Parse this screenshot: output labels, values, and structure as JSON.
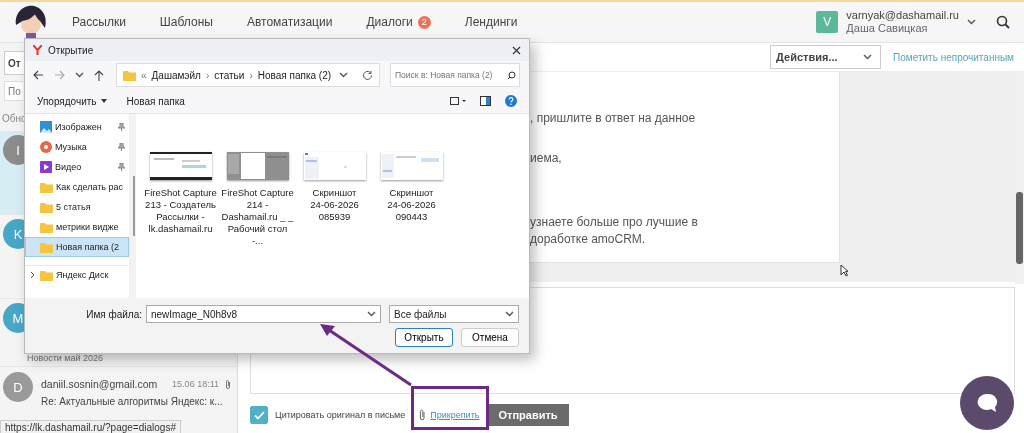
{
  "top_nav": {
    "links": [
      {
        "label": "Рассылки"
      },
      {
        "label": "Шаблоны"
      },
      {
        "label": "Автоматизации"
      },
      {
        "label": "Диалоги",
        "badge": "2"
      },
      {
        "label": "Лендинги"
      }
    ],
    "user": {
      "initial": "V",
      "email": "varnyak@dashamail.ru",
      "name": "Даша Савицкая"
    }
  },
  "sidebar": {
    "sort_value": "От",
    "search_placeholder": "По",
    "refresh_label": "Обно",
    "conversations": [
      {
        "initial": "I",
        "color": "#8c8c8c",
        "selected": true
      },
      {
        "initial": "K",
        "color": "#47a7c7",
        "selected": false
      },
      {
        "initial": "M",
        "color": "#47a7c7",
        "selected": false,
        "subject": "Новости май 2026"
      },
      {
        "initial": "D",
        "color": "#9a9a9a",
        "selected": false,
        "sender": "daniil.sosnin@gmail.com",
        "time": "15.06 18:11",
        "subject": "Re: Актуальные алгоритмы Яндекс: к...",
        "attachment": true
      }
    ]
  },
  "toolbar": {
    "actions": "Действия...",
    "mark_unread": "Пометить непрочитанным"
  },
  "message": {
    "paragraphs": [
      [
        ", пришлите в ответ на данное"
      ],
      [
        "иема,"
      ],
      [
        "узнаете больше про лучшие в",
        "доработке amoCRM."
      ]
    ]
  },
  "reply": {
    "quote_original": true,
    "quote_label": "Цитировать оригинал в письме",
    "attach": "Прикрепить",
    "send": "Отправить"
  },
  "status_url": "https://lk.dashamail.ru/?page=dialogs#",
  "file_dialog": {
    "title": "Открытие",
    "path_prefix": "«",
    "path": [
      {
        "label": "Дашамэйл"
      },
      {
        "separator": "›",
        "label": "статьи"
      },
      {
        "separator": "›",
        "label": "Новая папка (2)"
      }
    ],
    "search_placeholder": "Поиск в: Новая папка (2)",
    "organize": "Упорядочить",
    "new_folder": "Новая папка",
    "nav": [
      {
        "label": "Изображен",
        "kind": "images",
        "pinned": true,
        "selected": false
      },
      {
        "label": "Музыка",
        "kind": "music",
        "pinned": true,
        "selected": false
      },
      {
        "label": "Видео",
        "kind": "video",
        "pinned": true,
        "selected": false
      },
      {
        "label": "Как сделать рас",
        "kind": "folder",
        "pinned": false,
        "selected": false
      },
      {
        "label": "5 статья",
        "kind": "folder",
        "pinned": false,
        "selected": false
      },
      {
        "label": "метрики видже",
        "kind": "folder",
        "pinned": false,
        "selected": false
      },
      {
        "label": "Новая папка (2",
        "kind": "folder",
        "pinned": false,
        "selected": true
      },
      {
        "label": "Яндекс Диск",
        "kind": "folder",
        "pinned": false,
        "selected": false,
        "expandable": true
      }
    ],
    "files": [
      {
        "name": "FireShot Capture\n213 - Создатель\nРассылки -\nlk.dashamail.ru",
        "kind": "dark"
      },
      {
        "name": "FireShot Capture\n214 -\nDashamail.ru _ _\nРабочий стол -...",
        "kind": "grey"
      },
      {
        "name": "Скриншот\n24-06-2026\n085939",
        "kind": "light"
      },
      {
        "name": "Скриншот\n24-06-2026\n090443",
        "kind": "light2"
      }
    ],
    "filename_label": "Имя файла:",
    "filename": "newImage_N0h8v8",
    "filter": "Все файлы",
    "open": "Открыть",
    "cancel": "Отмена"
  }
}
